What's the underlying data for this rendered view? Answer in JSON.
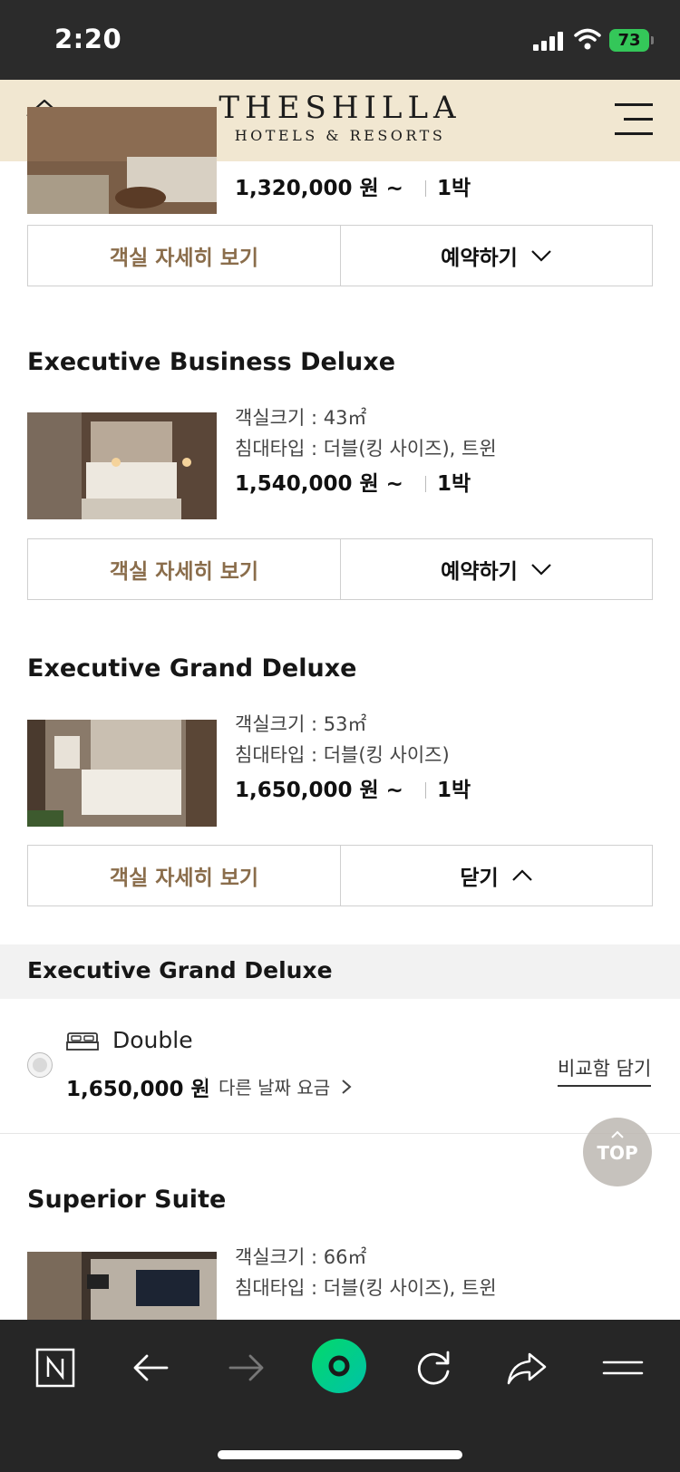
{
  "status": {
    "time": "2:20",
    "battery": "73"
  },
  "header": {
    "logo_main": "THESHILLA",
    "logo_sub": "HOTELS & RESORTS"
  },
  "rooms": [
    {
      "title": "",
      "size": "",
      "bed": "",
      "price": "1,320,000 원 ~",
      "nights": "1박",
      "detail_label": "객실 자세히 보기",
      "action_label": "예약하기",
      "photo_colors": [
        "#6a5240",
        "#c9c0b2"
      ]
    },
    {
      "title": "Executive Business Deluxe",
      "size": "객실크기 : 43㎡",
      "bed": "침대타입 : 더블(킹 사이즈), 트윈",
      "price": "1,540,000 원 ~",
      "nights": "1박",
      "detail_label": "객실 자세히 보기",
      "action_label": "예약하기",
      "photo_colors": [
        "#4a3a2e",
        "#d8d2c8"
      ]
    },
    {
      "title": "Executive Grand Deluxe",
      "size": "객실크기 : 53㎡",
      "bed": "침대타입 : 더블(킹 사이즈)",
      "price": "1,650,000 원 ~",
      "nights": "1박",
      "detail_label": "객실 자세히 보기",
      "action_label": "닫기",
      "photo_colors": [
        "#5a4636",
        "#cfc8bd"
      ]
    },
    {
      "title": "Superior Suite",
      "size": "객실크기 : 66㎡",
      "bed": "침대타입 : 더블(킹 사이즈), 트윈",
      "photo_colors": [
        "#3f342c",
        "#b9b0a4"
      ]
    }
  ],
  "expanded": {
    "title": "Executive Grand Deluxe",
    "bed_type": "Double",
    "price": "1,650,000 원",
    "other_dates": "다른 날짜 요금",
    "compare": "비교함 담기"
  },
  "top_button": "TOP",
  "colors": {
    "accent_brown": "#8a6d4b",
    "header_bg": "#f1e7d1",
    "naver_green": "#03c75a"
  }
}
